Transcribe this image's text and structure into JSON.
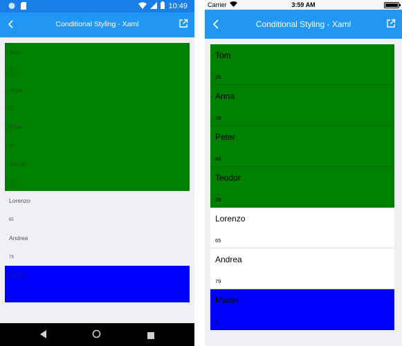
{
  "colors": {
    "green": "#008000",
    "blue": "#0000ff",
    "accent": "#2196f3",
    "white": "#ffffff"
  },
  "android": {
    "status_time": "10:49",
    "title": "Conditional Styling - Xaml",
    "items": [
      {
        "name": "Tom",
        "age": "25",
        "bg": "#008000",
        "fg": "#1f4f1f"
      },
      {
        "name": "Anna",
        "age": "18",
        "bg": "#008000",
        "fg": "#1f4f1f"
      },
      {
        "name": "Peter",
        "age": "43",
        "bg": "#008000",
        "fg": "#1f4f1f"
      },
      {
        "name": "Teodor",
        "age": "29",
        "bg": "#008000",
        "fg": "#1f4f1f"
      },
      {
        "name": "Lorenzo",
        "age": "65",
        "bg": "transparent",
        "fg": "#555555"
      },
      {
        "name": "Andrea",
        "age": "79",
        "bg": "transparent",
        "fg": "#555555"
      },
      {
        "name": "Martin",
        "age": "5",
        "bg": "#0000ff",
        "fg": "#1a1a6e"
      }
    ]
  },
  "ios": {
    "carrier": "Carrier",
    "status_time": "3:59 AM",
    "title": "Conditional Styling - Xaml",
    "items": [
      {
        "name": "Tom",
        "age": "25",
        "bg": "#008000",
        "fg": "#000000"
      },
      {
        "name": "Anna",
        "age": "18",
        "bg": "#008000",
        "fg": "#000000"
      },
      {
        "name": "Peter",
        "age": "43",
        "bg": "#008000",
        "fg": "#000000"
      },
      {
        "name": "Teodor",
        "age": "29",
        "bg": "#008000",
        "fg": "#000000"
      },
      {
        "name": "Lorenzo",
        "age": "65",
        "bg": "#ffffff",
        "fg": "#000000"
      },
      {
        "name": "Andrea",
        "age": "79",
        "bg": "#ffffff",
        "fg": "#000000"
      },
      {
        "name": "Martin",
        "age": "5",
        "bg": "#0000ff",
        "fg": "#000000"
      }
    ]
  }
}
